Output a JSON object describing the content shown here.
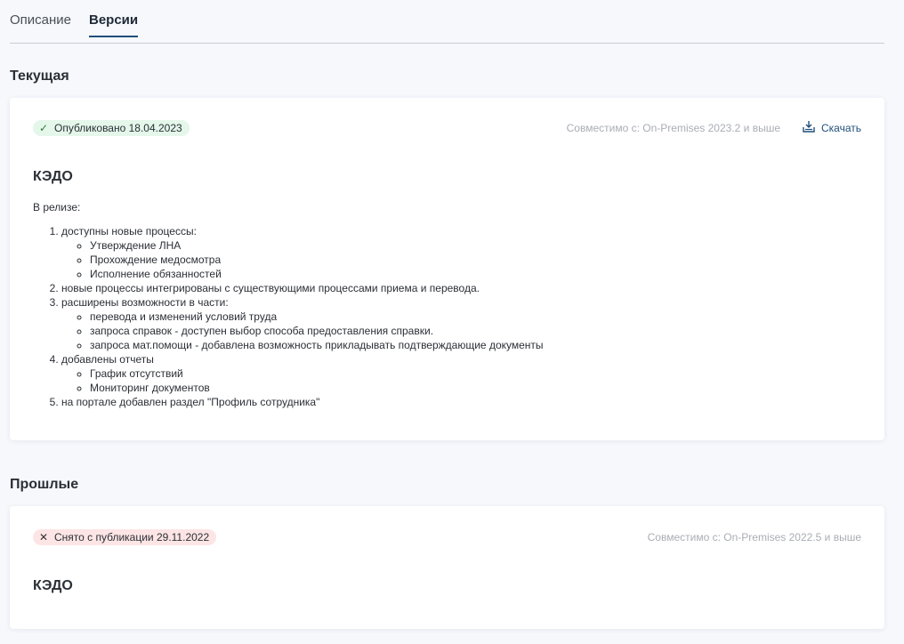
{
  "tabs": [
    {
      "label": "Описание",
      "active": false
    },
    {
      "label": "Версии",
      "active": true
    }
  ],
  "current": {
    "section_title": "Текущая",
    "badge": "Опубликовано 18.04.2023",
    "badge_icon": "check-icon",
    "compat": "Совместимо с: On-Premises 2023.2 и выше",
    "download_label": "Скачать",
    "title": "КЭДО",
    "intro": "В релизе:",
    "items": [
      {
        "text": "доступны новые процессы:",
        "sub": [
          "Утверждение ЛНА",
          "Прохождение медосмотра",
          "Исполнение обязанностей"
        ]
      },
      {
        "text": "новые процессы интегрированы с существующими процессами приема и перевода.",
        "sub": []
      },
      {
        "text": "расширены возможности в части:",
        "sub": [
          "перевода и изменений условий труда",
          "запроса справок - доступен выбор способа предоставления справки.",
          "запроса мат.помощи - добавлена возможность прикладывать подтверждающие документы"
        ]
      },
      {
        "text": "добавлены отчеты",
        "sub": [
          "График отсутствий",
          "Мониторинг документов"
        ]
      },
      {
        "text": "на портале добавлен раздел \"Профиль сотрудника\"",
        "sub": []
      }
    ]
  },
  "past": {
    "section_title": "Прошлые",
    "badge": "Снято с публикации 29.11.2022",
    "badge_icon": "x-icon",
    "compat": "Совместимо с: On-Premises 2022.5 и выше",
    "title": "КЭДО"
  },
  "colors": {
    "accent": "#1f4e79",
    "published_bg": "#e4f7ea",
    "unpublished_bg": "#fde5e5"
  }
}
